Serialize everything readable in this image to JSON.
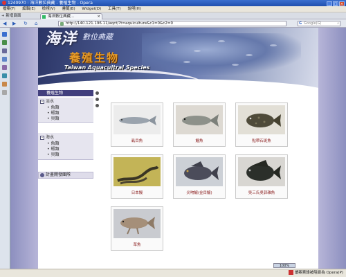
{
  "window": {
    "title": "1240970 : 海洋數位典藏 - 養殖生物 - Opera",
    "buttons": [
      "_",
      "□",
      "×"
    ]
  },
  "menu": [
    "檔案(F)",
    "編輯(E)",
    "檢視(V)",
    "書籤(B)",
    "Widget(D)",
    "工具(T)",
    "說明(H)"
  ],
  "tabs": {
    "new_tab": "+ 新增頁面",
    "active": {
      "label": "海洋數位典藏...",
      "close": "×"
    }
  },
  "nav_icons": [
    "◀",
    "▶",
    "↻",
    "⌂"
  ],
  "address": {
    "url": "http://140.121.196.11/aqct/?t=aquiculture&c1=0&c2=0"
  },
  "search": {
    "engine": "G",
    "placeholder": "Google(G)",
    "icon": "⌕"
  },
  "banner": {
    "title_main": "海洋",
    "title_sub": "數位典藏",
    "section_cn": "養殖生物",
    "section_en": "Taiwan Aquacultral Species"
  },
  "sidebar": {
    "heading": "養殖生物",
    "groups": [
      {
        "label": "淡水",
        "toggle": "−",
        "items": [
          "魚類",
          "蝦類",
          "貝類"
        ]
      },
      {
        "label": "海水",
        "toggle": "−",
        "items": [
          "魚類",
          "蝦類",
          "貝類"
        ]
      }
    ],
    "team_label": "計畫開發團隊"
  },
  "species": [
    {
      "name": "虱目魚",
      "bg": "#e9e9e9",
      "fish": "#9aa3ad"
    },
    {
      "name": "鯔魚",
      "bg": "#ddd9d2",
      "fish": "#8d918a"
    },
    {
      "name": "點帶石斑魚",
      "bg": "#e2dfd6",
      "fish": "#4f4b3a"
    },
    {
      "name": "日本鰻",
      "bg": "#c3b457",
      "fish": "#3a3524"
    },
    {
      "name": "尖吻鱸(金目鱸)",
      "bg": "#ccd0d6",
      "fish": "#4b4c5a"
    },
    {
      "name": "吳三氏吳郭雜魚",
      "bg": "#d8d6d2",
      "fish": "#2b2f2a"
    },
    {
      "name": "草魚",
      "bg": "#c9cbd0",
      "fish": "#a58f79"
    }
  ],
  "status": {
    "zoom": "100%",
    "text": "讀案賣錄被阻斷為 Opera(P)"
  }
}
